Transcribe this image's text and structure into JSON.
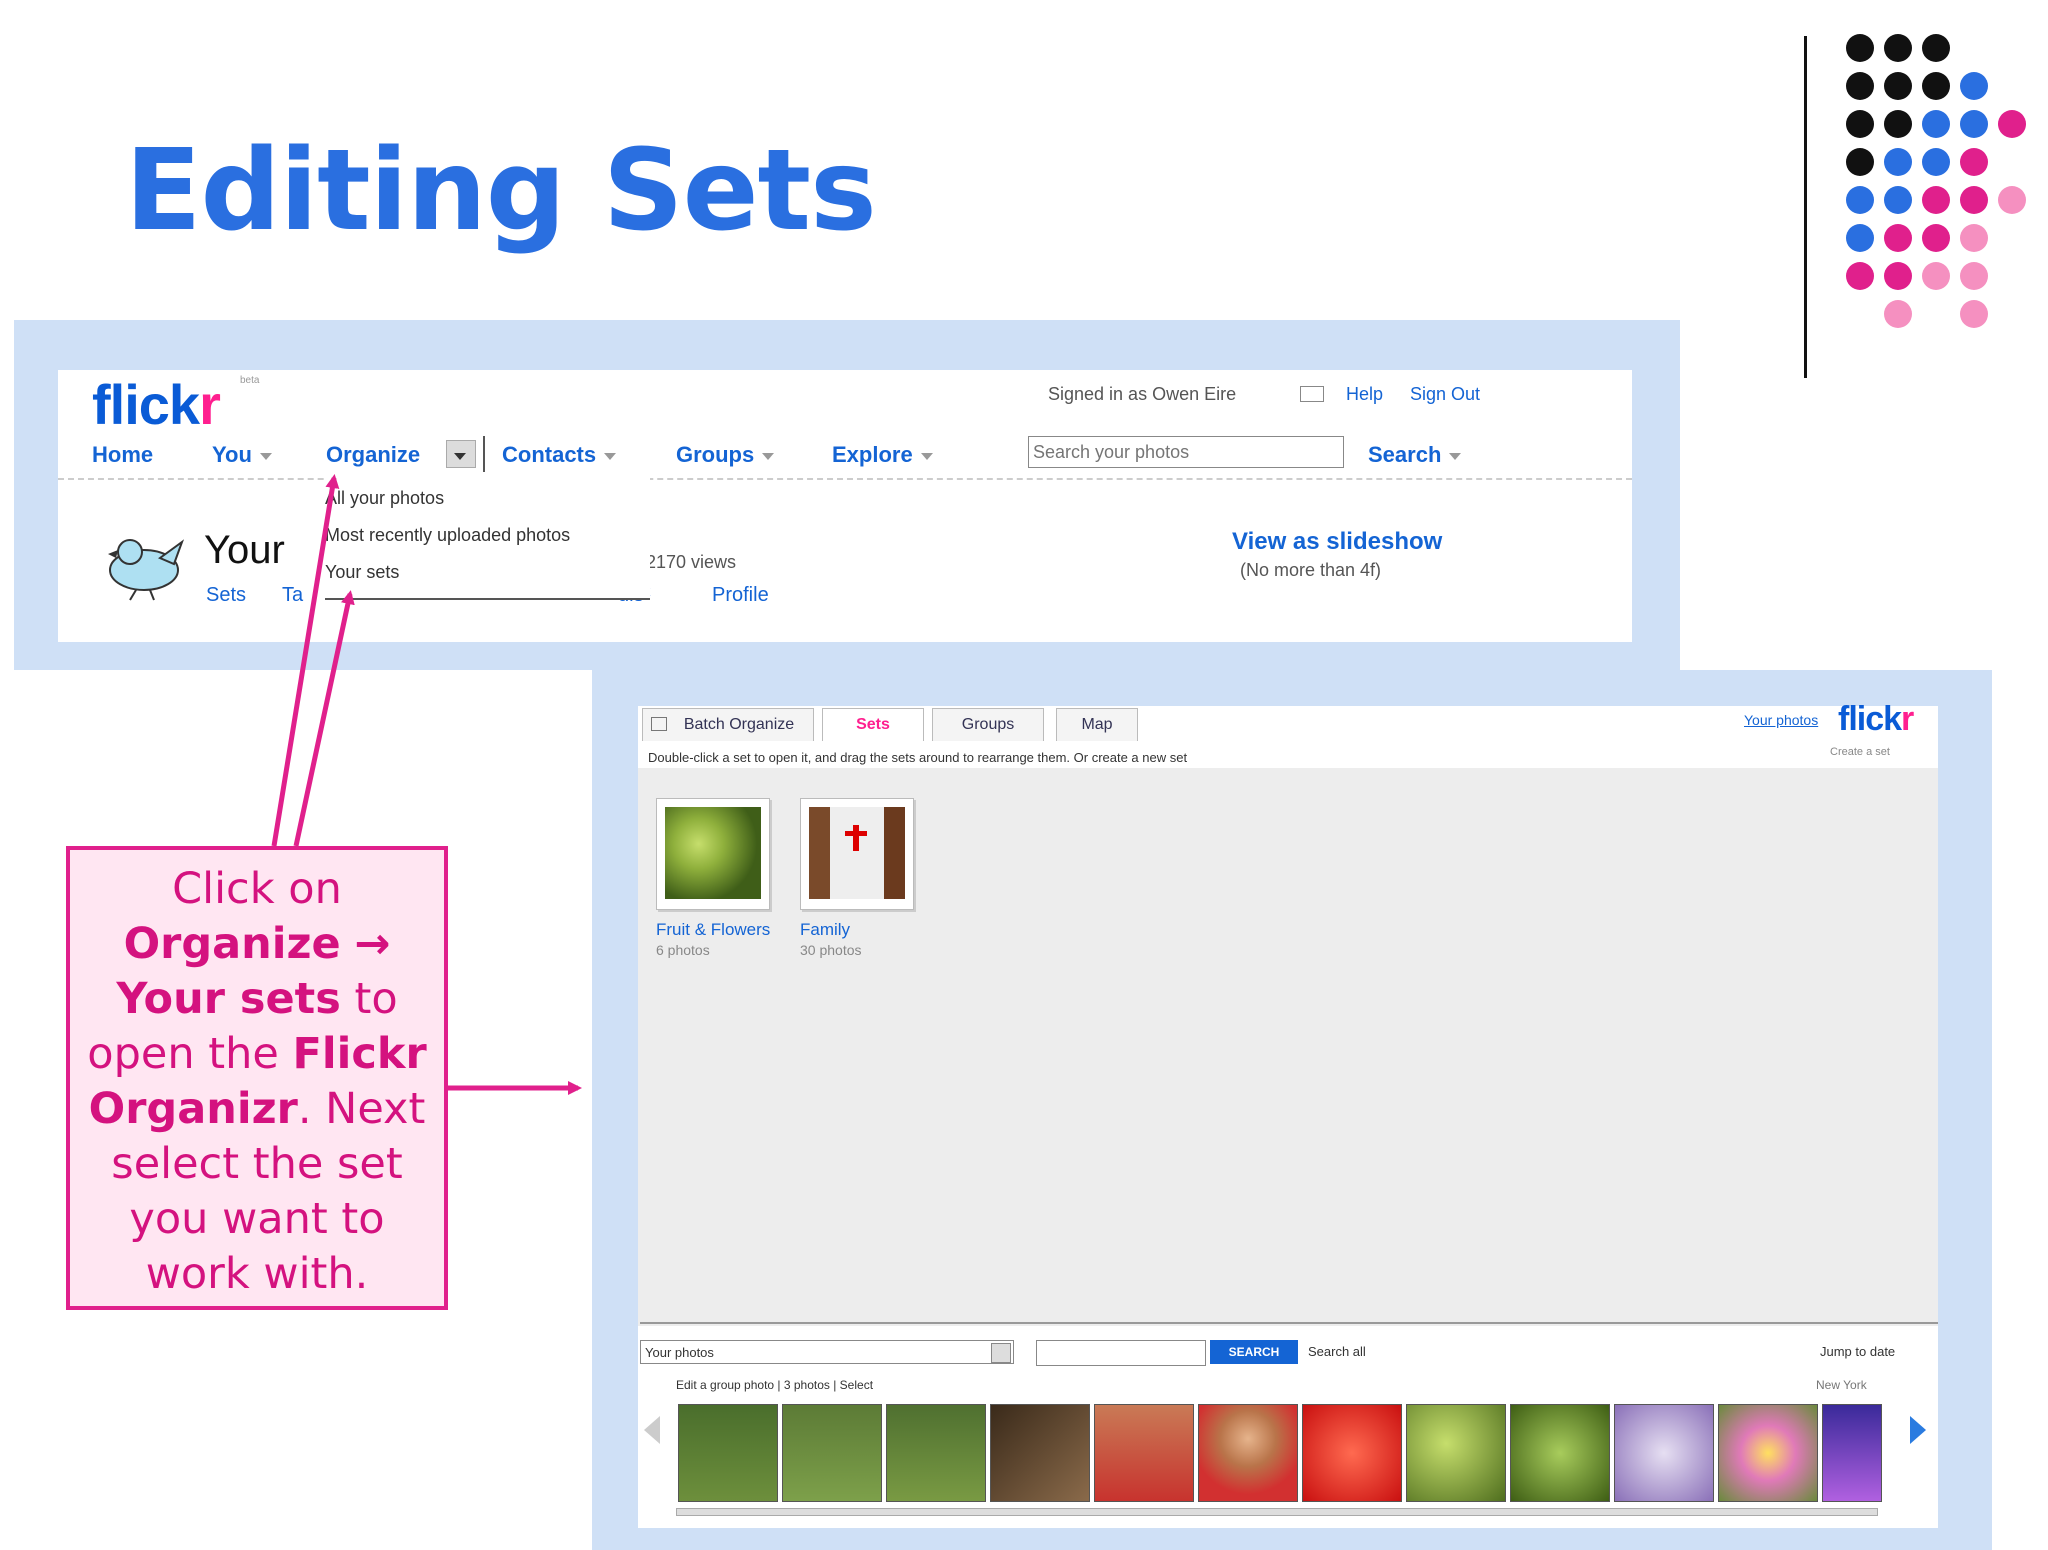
{
  "slide": {
    "title": "Editing Sets"
  },
  "flickr_header": {
    "logo_text_blue": "flick",
    "logo_text_pink": "r",
    "logo_badge": "beta",
    "signed_in": "Signed in as Owen Eire",
    "help": "Help",
    "sign_out": "Sign Out",
    "nav": {
      "home": "Home",
      "you": "You",
      "organize": "Organize",
      "contacts": "Contacts",
      "groups": "Groups",
      "explore": "Explore"
    },
    "search_placeholder": "Search your photos",
    "search_button": "Search",
    "organize_menu": [
      "All your photos",
      "Most recently uploaded photos",
      "Your sets"
    ],
    "your_heading": "Your",
    "views_text": "2170 views",
    "subnav_sets": "Sets",
    "subnav_tags": "Ta",
    "subnav_profile": "Profile",
    "subnav_fragment": "ulsᵏ",
    "slideshow_link": "View as slideshow",
    "slideshow_note": "(No more than 4f)"
  },
  "organizr": {
    "tabs": [
      "Batch Organize",
      "Sets",
      "Groups",
      "Map"
    ],
    "logo_text_blue": "flick",
    "logo_text_pink": "r",
    "your_photos_link": "Your photos",
    "instruction": "Double-click a set to open it, and drag the sets around to rearrange them. Or create a new set",
    "corner_text": "Create a set",
    "sets": [
      {
        "name": "Fruit & Flowers",
        "count": "6 photos"
      },
      {
        "name": "Family",
        "count": "30 photos"
      }
    ],
    "filter_select": "Your photos",
    "search_button": "SEARCH",
    "search_all": "Search all",
    "jump_to": "Jump to date",
    "date_info": "Edit a group photo  |  3 photos  |  Select",
    "date_text": "New York"
  },
  "callout": {
    "l1": "Click on",
    "organize": "Organize",
    "arrow": "→",
    "your_sets": "Your sets",
    "to": "to",
    "open_the": "open the",
    "flickr": "Flickr",
    "organizr": "Organizr",
    "next": ".  Next",
    "l_select": "select the set",
    "l_you": "you want to",
    "l_work": "work with."
  },
  "colors": {
    "title_blue": "#2a6fe0",
    "accent_pink": "#e0208c",
    "panel_blue": "#cfe0f6",
    "flickr_blue": "#0a5bd6",
    "flickr_pink": "#ff1f8f"
  },
  "icons": [
    "mail-icon",
    "bird-icon",
    "batch-organize-icon",
    "scroll-left-icon",
    "scroll-right-icon"
  ]
}
